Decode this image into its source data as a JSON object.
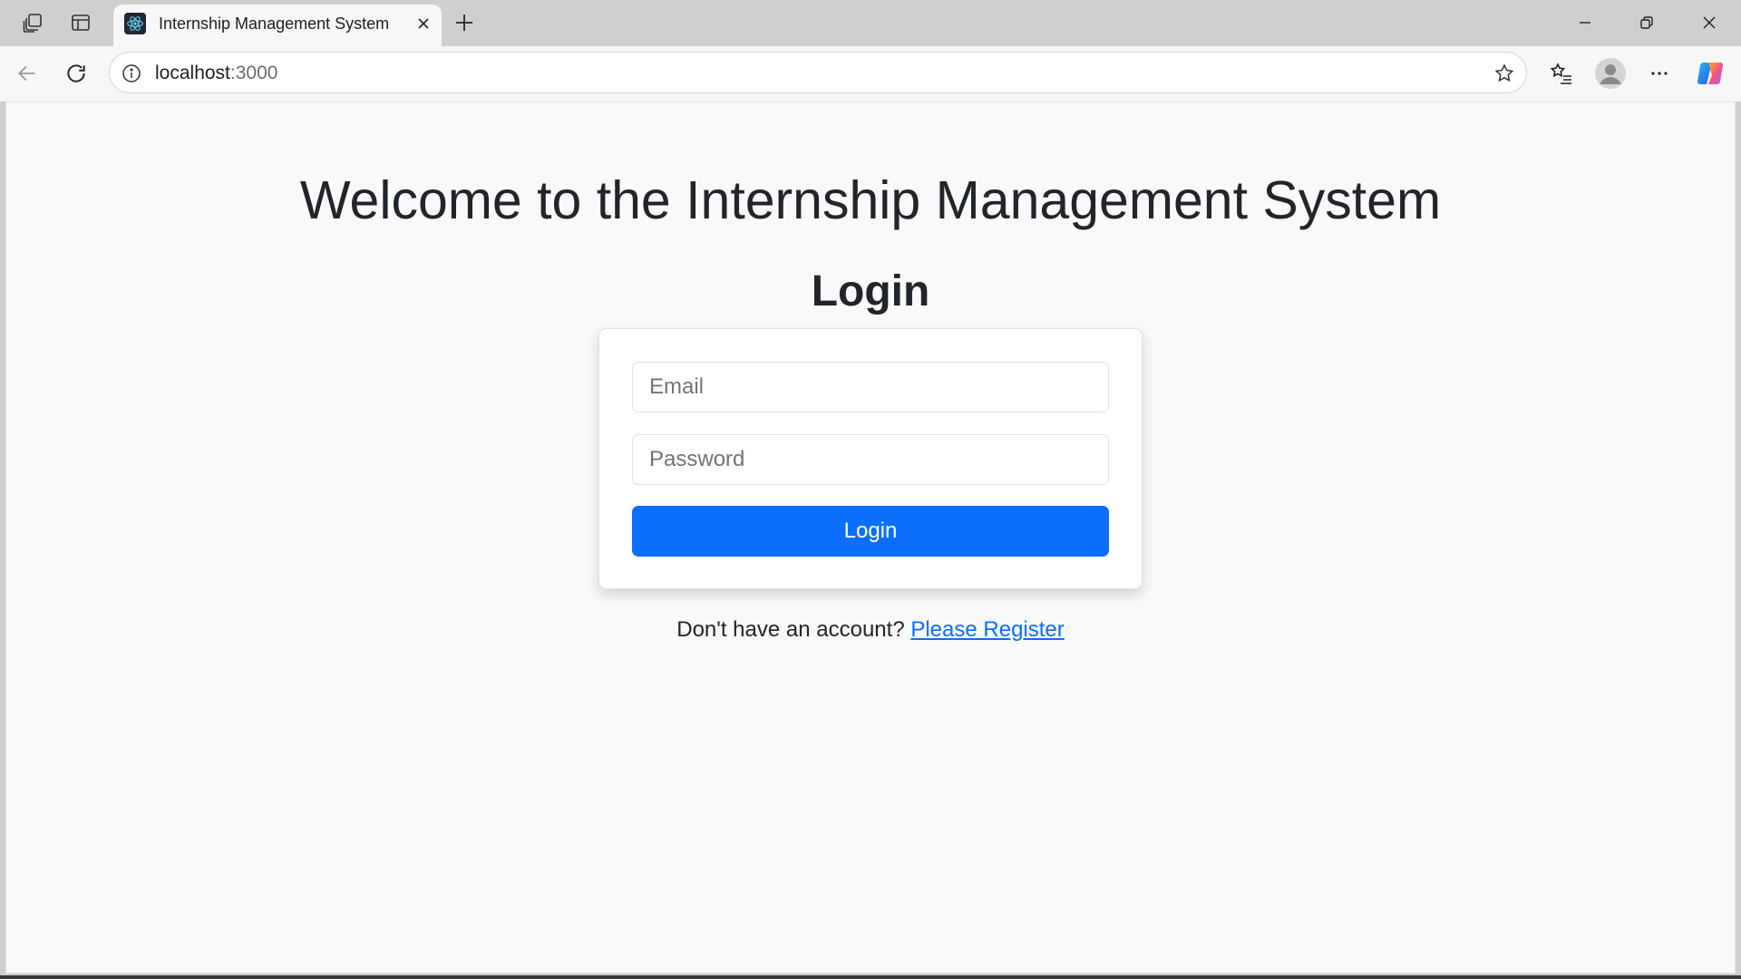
{
  "browser": {
    "tab_title": "Internship Management System",
    "url_host": "localhost",
    "url_port": ":3000",
    "icons": [
      "workspaces-icon",
      "tab-actions-icon",
      "react-favicon-icon",
      "close-tab-icon",
      "new-tab-icon",
      "minimize-icon",
      "restore-icon",
      "close-window-icon",
      "back-icon",
      "refresh-icon",
      "site-info-icon",
      "favorite-star-icon",
      "favorites-icon",
      "profile-icon",
      "more-icon",
      "copilot-icon"
    ]
  },
  "page": {
    "heading": "Welcome to the Internship Management System",
    "login_title": "Login",
    "email_placeholder": "Email",
    "password_placeholder": "Password",
    "login_button": "Login",
    "register_prompt": "Don't have an account?",
    "register_link": "Please Register"
  },
  "colors": {
    "primary": "#0d6efd",
    "page_background": "#f8f9fa",
    "text": "#212529"
  }
}
